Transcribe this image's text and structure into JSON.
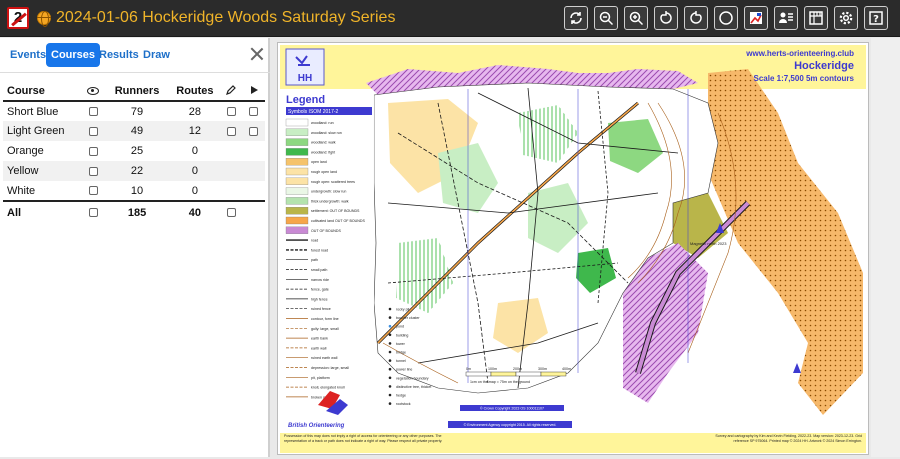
{
  "app": {
    "title": "2024-01-06 Hockeridge Woods Saturday Series",
    "logo_glyph": "2",
    "toolbar_icons": [
      "reset-view-icon",
      "zoom-out-icon",
      "zoom-in-icon",
      "rotate-left-icon",
      "rotate-right-icon",
      "circle-icon",
      "georeference-icon",
      "users-icon",
      "ruler-icon",
      "gear-icon",
      "help-icon"
    ]
  },
  "panel": {
    "tabs": [
      "Events",
      "Courses",
      "Results",
      "Draw"
    ],
    "active_tab": "Courses",
    "columns": [
      "Course",
      "Runners",
      "Routes"
    ],
    "rows": [
      {
        "course": "Short Blue",
        "runners": "79",
        "routes": "28"
      },
      {
        "course": "Light Green",
        "runners": "49",
        "routes": "12"
      },
      {
        "course": "Orange",
        "runners": "25",
        "routes": "0"
      },
      {
        "course": "Yellow",
        "runners": "22",
        "routes": "0"
      },
      {
        "course": "White",
        "runners": "10",
        "routes": "0"
      }
    ],
    "total": {
      "course": "All",
      "runners": "185",
      "routes": "40"
    }
  },
  "map": {
    "club_url": "www.herts-orienteering.club",
    "name": "Hockeridge",
    "scale": "Scale 1:7,500  5m contours",
    "legend_title": "Legend",
    "legend_subtitle": "Symbols ISOM 2017-2",
    "legend_items": [
      "woodland: run",
      "woodland: slow run",
      "woodland: walk",
      "woodland: fight",
      "open land",
      "rough open land",
      "rough open: scattered trees",
      "undergrowth: slow run",
      "thick undergrowth: walk",
      "settlement: OUT OF BOUNDS",
      "cultivated land OUT OF BOUNDS",
      "OUT OF BOUNDS",
      "road",
      "forest road",
      "path",
      "small path",
      "narrow ride",
      "fence, gate",
      "high fence",
      "ruined fence",
      "contour, form line",
      "gully: large, small",
      "earth bank",
      "earth wall",
      "ruined earth wall",
      "depression: large, small",
      "pit, platform",
      "knoll, elongated knoll",
      "broken ground"
    ],
    "legend_items_right": [
      "rocky pit",
      "boulder cluster",
      "pond",
      "building",
      "tower",
      "bridge",
      "tunnel",
      "power line",
      "vegetation boundary",
      "distinctive tree, thicket",
      "hedge",
      "rootstock"
    ],
    "bo_label": "British Orienteering",
    "copyright_1": "© Crown Copyright 2023 OS 100011107",
    "copyright_2": "© Environment Agency copyright 2015. All rights reserved.",
    "scale_labels": [
      "0m",
      "100m",
      "200m",
      "300m",
      "400m"
    ],
    "scale_note": "1cm on the map = 75m on the ground",
    "magnetic_label": "Magnetic north 2023",
    "footer_left": "Possession of this map does not imply a right of access for orienteering or any other purposes. The representation of a track or path does not indicate a right of way. Please respect all private property.",
    "footer_right": "Survey and cartography by Kim and Kevin Fielding, 2022-23. Map version: 2023-12-23. Grid reference SP 975064. Printed map © 2024 HH. Artwork © 2024 Simon Errington.",
    "colors": {
      "open": "#f5c36b",
      "rough": "#fce3a6",
      "wood_slow": "#c8eec4",
      "wood_walk": "#8dd881",
      "wood_fight": "#3fb84c",
      "oob": "#c98ad4",
      "olive": "#b9b54a",
      "path": "#1a1a1a",
      "contour": "#a85f1a",
      "road_fill": "#f6a64a",
      "header": "#fff59a",
      "legend_blue": "#3d3ad0"
    }
  }
}
